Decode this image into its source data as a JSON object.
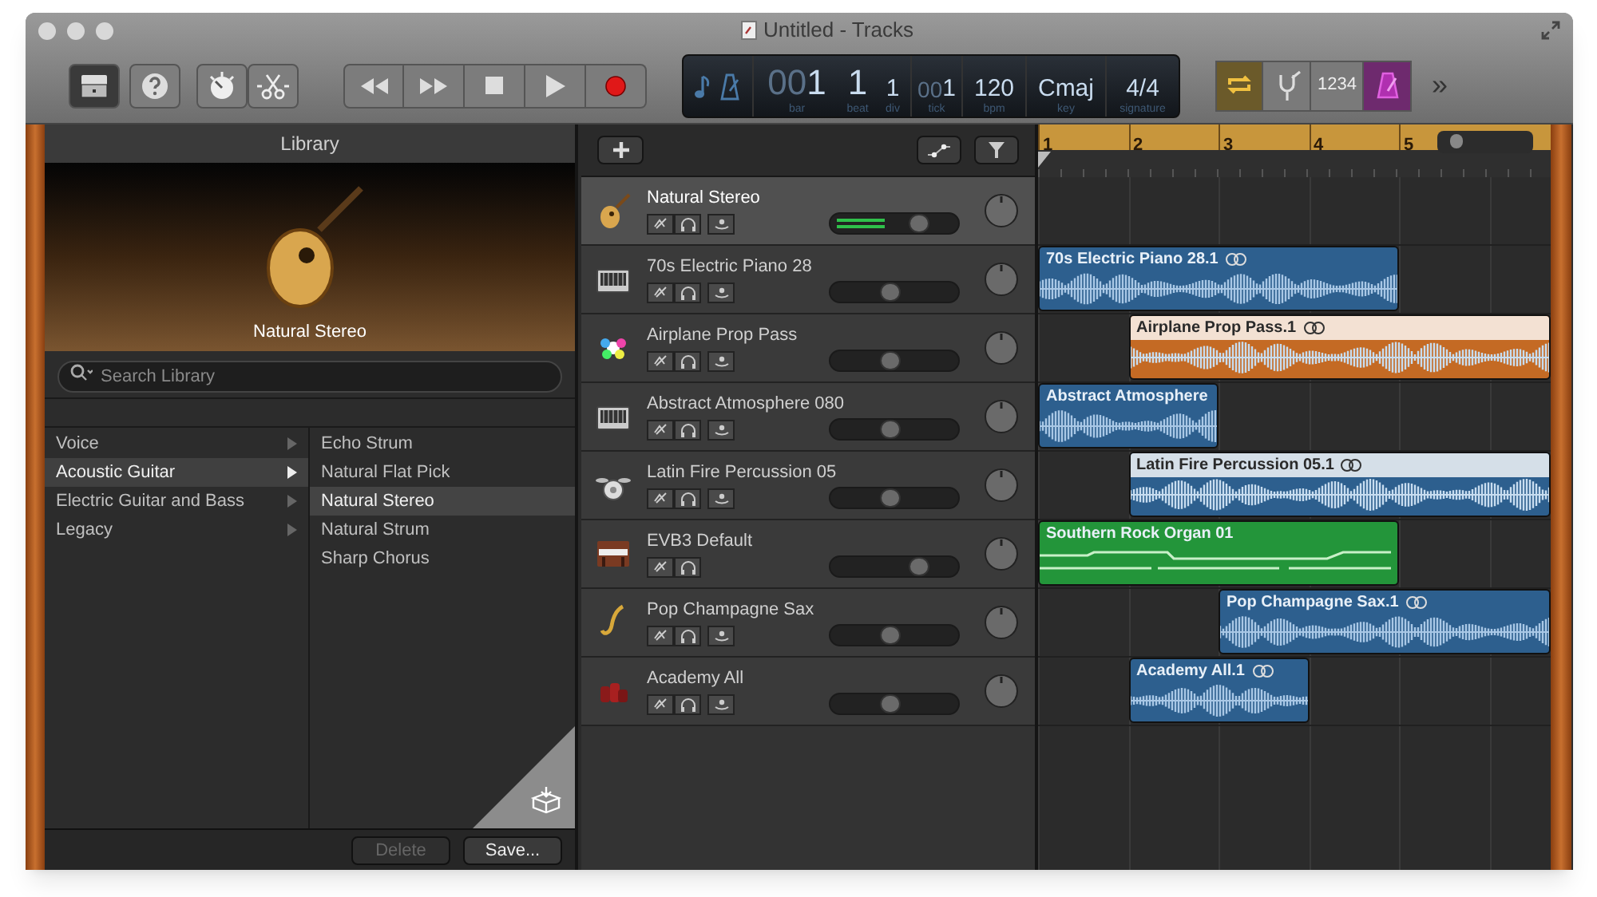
{
  "window": {
    "title": "Untitled - Tracks"
  },
  "toolbar": {
    "left_buttons": [
      {
        "kind": "library",
        "on": true
      },
      {
        "kind": "help",
        "on": false
      },
      {
        "kind": "smart-controls",
        "on": false
      },
      {
        "kind": "editors",
        "on": false
      }
    ],
    "transport": [
      {
        "kind": "rewind"
      },
      {
        "kind": "forward"
      },
      {
        "kind": "stop"
      },
      {
        "kind": "play"
      },
      {
        "kind": "record"
      }
    ],
    "lcd": [
      {
        "dim": "00",
        "value": "1",
        "label": "bar"
      },
      {
        "value": "1",
        "label": "beat"
      },
      {
        "value": "1",
        "label": "div"
      },
      {
        "dim": "00",
        "value": "1",
        "label": "tick"
      },
      {
        "value": "120",
        "label": "bpm"
      },
      {
        "value": "Cmaj",
        "label": "key"
      },
      {
        "value": "4/4",
        "label": "signature"
      }
    ],
    "right_buttons": [
      {
        "kind": "cycle",
        "on": true
      },
      {
        "kind": "tuner",
        "on": false
      },
      {
        "kind": "count-in",
        "on": false,
        "text": "1234"
      },
      {
        "kind": "metronome",
        "on": true
      }
    ],
    "more": "»"
  },
  "library": {
    "title": "Library",
    "caption": "Natural Stereo",
    "search": {
      "placeholder": "Search Library"
    },
    "categories": [
      {
        "label": "Voice",
        "selected": false
      },
      {
        "label": "Acoustic Guitar",
        "selected": true
      },
      {
        "label": "Electric Guitar and Bass",
        "selected": false
      },
      {
        "label": "Legacy",
        "selected": false
      }
    ],
    "presets": [
      {
        "label": "Echo Strum",
        "selected": false
      },
      {
        "label": "Natural Flat Pick",
        "selected": false
      },
      {
        "label": "Natural Stereo",
        "selected": true
      },
      {
        "label": "Natural Strum",
        "selected": false
      },
      {
        "label": "Sharp Chorus",
        "selected": false
      }
    ],
    "buttons": [
      {
        "label": "Delete",
        "disabled": true
      },
      {
        "label": "Save...",
        "disabled": false
      }
    ]
  },
  "timeline": {
    "ruler": [
      "1",
      "2",
      "3",
      "4",
      "5"
    ],
    "zoom": {
      "level": 0.15
    }
  },
  "tracks": [
    {
      "name": "Natural Stereo",
      "kind": "guitar",
      "selected": true,
      "playing": true,
      "level": 0.7
    },
    {
      "name": "70s Electric Piano 28",
      "kind": "piano",
      "selected": false,
      "playing": false,
      "level": 0.48,
      "region": {
        "label": "70s Electric Piano 28.1",
        "kind": "audio",
        "color": "#2d5f8e",
        "selected": false,
        "loop": true
      }
    },
    {
      "name": "Airplane Prop Pass",
      "kind": "sparkle",
      "selected": false,
      "playing": false,
      "level": 0.48,
      "region": {
        "label": "Airplane Prop Pass.1",
        "kind": "audio",
        "color": "#c46a24",
        "selected": true,
        "loop": true
      }
    },
    {
      "name": "Abstract Atmosphere 080",
      "kind": "piano",
      "selected": false,
      "playing": false,
      "level": 0.48,
      "region": {
        "label": "Abstract Atmosphere",
        "kind": "audio",
        "color": "#2d5f8e",
        "selected": false,
        "loop": false
      }
    },
    {
      "name": "Latin Fire Percussion 05",
      "kind": "drums",
      "selected": false,
      "playing": false,
      "level": 0.48,
      "region": {
        "label": "Latin Fire Percussion 05.1",
        "kind": "audio",
        "color": "#2d5f8e",
        "selected": true,
        "loop": true
      }
    },
    {
      "name": "EVB3 Default",
      "kind": "organ",
      "selected": false,
      "playing": false,
      "level": 0.7,
      "region": {
        "label": "Southern Rock Organ 01",
        "kind": "midi",
        "color": "#23953a",
        "selected": false,
        "loop": false
      }
    },
    {
      "name": "Pop Champagne Sax",
      "kind": "sax",
      "selected": false,
      "playing": false,
      "level": 0.48,
      "region": {
        "label": "Pop Champagne Sax.1",
        "kind": "audio",
        "color": "#2d5f8e",
        "selected": false,
        "loop": true
      }
    },
    {
      "name": "Academy All",
      "kind": "percussion",
      "selected": false,
      "playing": false,
      "level": 0.48,
      "region": {
        "label": "Academy All.1",
        "kind": "audio",
        "color": "#2d5f8e",
        "selected": false,
        "loop": true
      }
    }
  ]
}
